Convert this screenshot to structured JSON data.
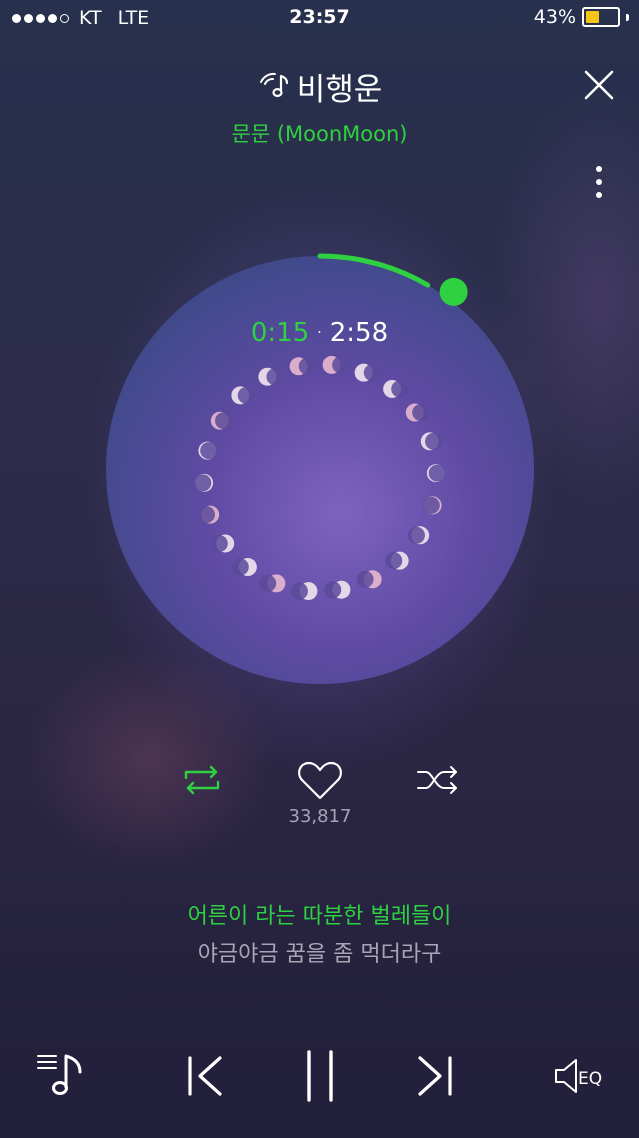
{
  "status_bar": {
    "carrier": "KT",
    "network": "LTE",
    "time": "23:57",
    "battery_percent": "43%",
    "battery_level": 0.43,
    "signal_bars_filled": 4,
    "signal_bars_total": 5
  },
  "track": {
    "title": "비행운",
    "artist": "문문 (MoonMoon)"
  },
  "playback": {
    "current_time": "0:15",
    "separator": "·",
    "total_time": "2:58",
    "progress_fraction": 0.084
  },
  "actions": {
    "like_count": "33,817",
    "repeat_active": true
  },
  "lyrics": {
    "current_line": "어른이 라는 따분한 벌레들이",
    "next_line": "야금야금 꿈을 좀 먹더라구"
  },
  "controls": {
    "eq_label": "EQ"
  },
  "colors": {
    "accent": "#2ed13f",
    "muted_text": "#a8a6b6",
    "battery": "#f5c518"
  },
  "icons": [
    "music-note-icon",
    "close-icon",
    "more-icon",
    "repeat-icon",
    "heart-icon",
    "shuffle-icon",
    "playlist-icon",
    "previous-icon",
    "pause-icon",
    "next-icon",
    "eq-icon"
  ]
}
